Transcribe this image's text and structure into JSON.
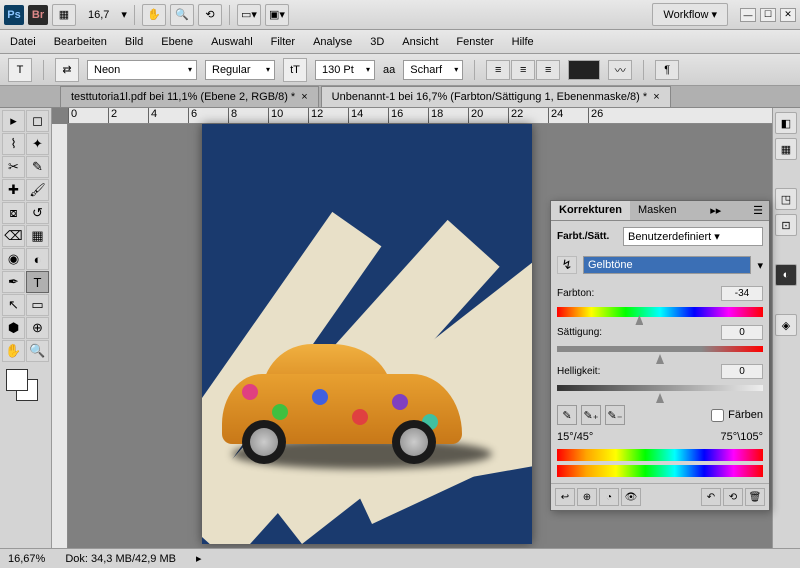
{
  "titlebar": {
    "zoom": "16,7",
    "workflow": "Workflow ▾"
  },
  "menu": [
    "Datei",
    "Bearbeiten",
    "Bild",
    "Ebene",
    "Auswahl",
    "Filter",
    "Analyse",
    "3D",
    "Ansicht",
    "Fenster",
    "Hilfe"
  ],
  "options": {
    "font": "Neon",
    "weight": "Regular",
    "size": "130 Pt",
    "aa_label": "aa",
    "aa": "Scharf"
  },
  "tabs": [
    {
      "label": "testtutoria1l.pdf bei 11,1% (Ebene 2, RGB/8) *",
      "active": false
    },
    {
      "label": "Unbenannt-1 bei 16,7% (Farbton/Sättigung 1, Ebenenmaske/8) *",
      "active": true
    }
  ],
  "ruler": [
    "0",
    "2",
    "4",
    "6",
    "8",
    "10",
    "12",
    "14",
    "16",
    "18",
    "20",
    "22",
    "24",
    "26"
  ],
  "panel": {
    "tab1": "Korrekturen",
    "tab2": "Masken",
    "title": "Farbt./Sätt.",
    "preset": "Benutzerdefiniert",
    "channel": "Gelbtöne",
    "hue_label": "Farbton:",
    "hue_val": "-34",
    "sat_label": "Sättigung:",
    "sat_val": "0",
    "lig_label": "Helligkeit:",
    "lig_val": "0",
    "colorize": "Färben",
    "range_left": "15°/45°",
    "range_right": "75°\\105°"
  },
  "status": {
    "zoom": "16,67%",
    "doc": "Dok: 34,3 MB/42,9 MB"
  }
}
